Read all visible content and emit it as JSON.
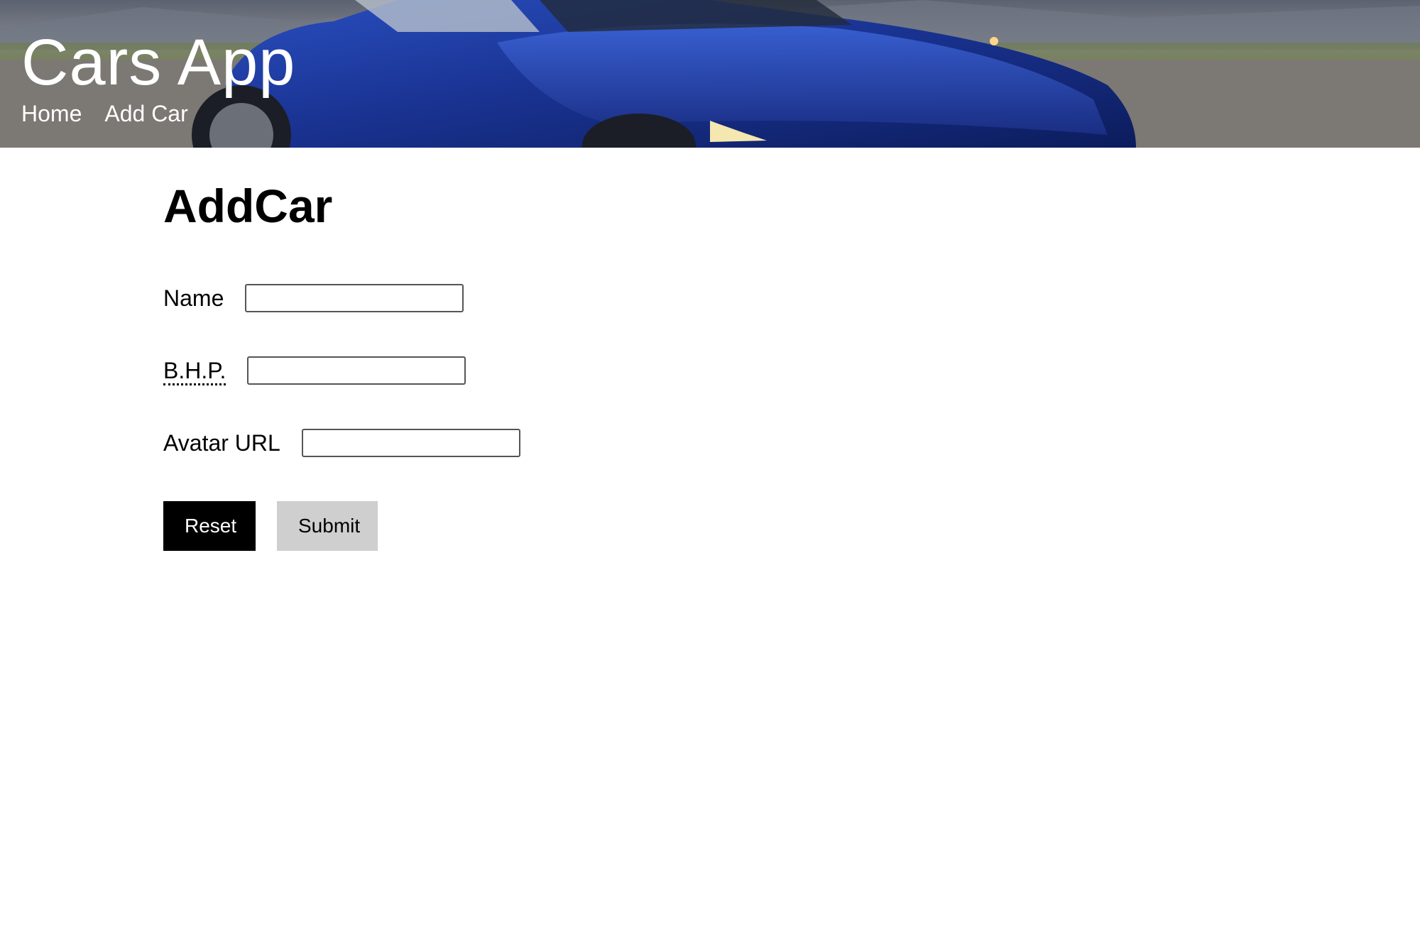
{
  "header": {
    "title": "Cars App",
    "nav": [
      "Home",
      "Add Car"
    ]
  },
  "main": {
    "title": "AddCar",
    "fields": {
      "name": {
        "label": "Name",
        "value": ""
      },
      "bhp": {
        "label": "B.H.P.",
        "value": ""
      },
      "avatar": {
        "label": "Avatar URL",
        "value": ""
      }
    },
    "buttons": {
      "reset": "Reset",
      "submit": "Submit"
    }
  },
  "colors": {
    "car_body": "#1d3b9a",
    "reset_bg": "#000000",
    "submit_bg": "#cfcfcf"
  }
}
